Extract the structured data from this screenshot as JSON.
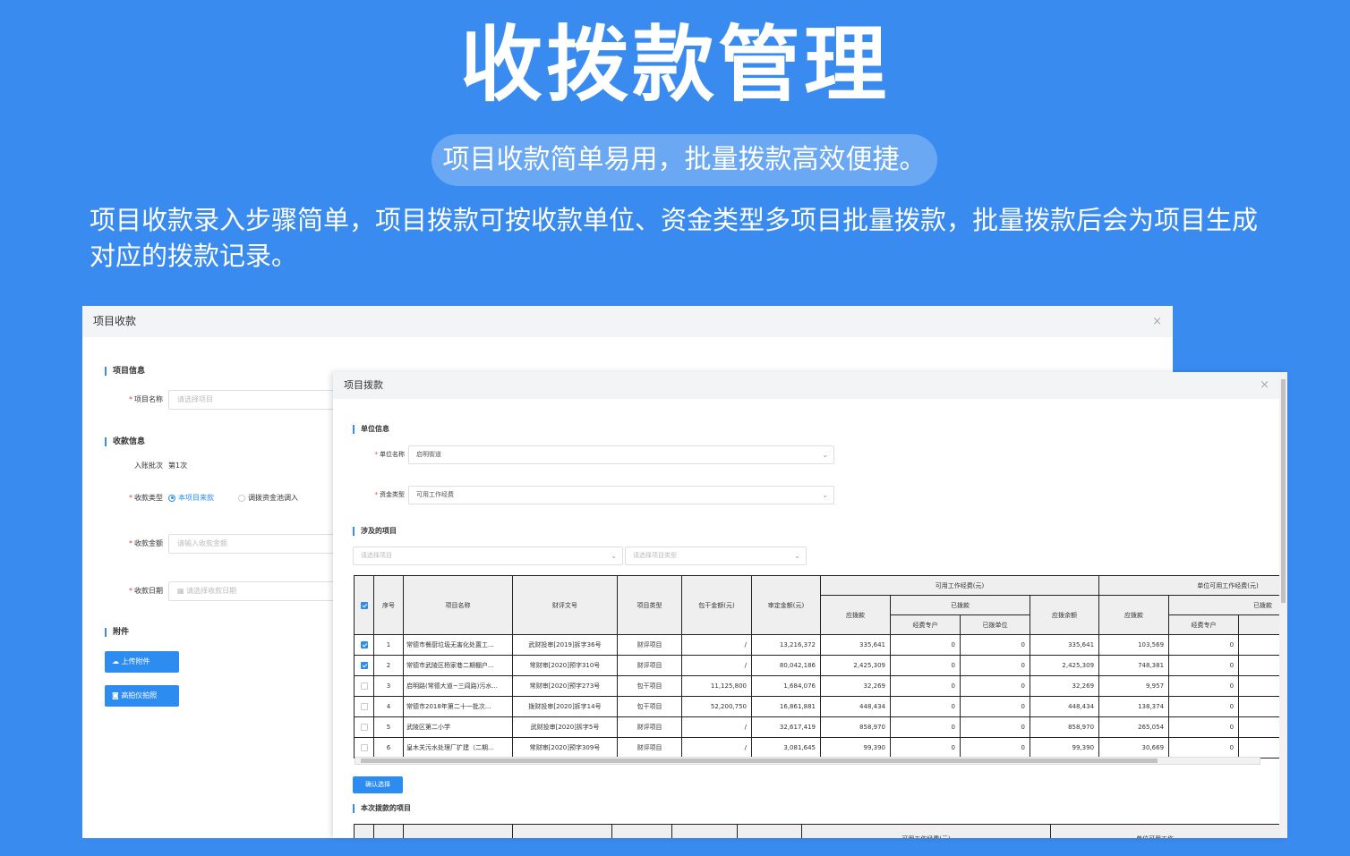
{
  "hero": {
    "title": "收拨款管理",
    "pill": "项目收款简单易用，批量拨款高效便捷。",
    "desc": "项目收款录入步骤简单，项目拨款可按收款单位、资金类型多项目批量拨款，批量拨款后会为项目生成对应的拨款记录。"
  },
  "receipt_dialog": {
    "title": "项目收款",
    "close": "×",
    "section_project": "项目信息",
    "project_name_label": "项目名称",
    "project_name_placeholder": "请选择项目",
    "section_receipt": "收款信息",
    "batch_label": "入账批次",
    "batch_value": "第1次",
    "type_label": "收款类型",
    "type_option_1": "本项目来款",
    "type_option_2": "调拨资金池调入",
    "amount_label": "收款金额",
    "amount_placeholder": "请输入收款金额",
    "date_label": "收款日期",
    "date_placeholder": "请选择收款日期",
    "section_attach": "附件",
    "upload_button": "上传附件",
    "camera_button": "高拍仪拍照"
  },
  "allocation_dialog": {
    "title": "项目拨款",
    "close": "×",
    "section_unit": "单位信息",
    "unit_name_label": "单位名称",
    "unit_name_value": "启明街道",
    "fund_type_label": "资金类型",
    "fund_type_value": "可用工作经费",
    "section_projects": "涉及的项目",
    "filter_project_placeholder": "请选择项目",
    "filter_type_placeholder": "请选择项目类型",
    "confirm_button": "确认选择",
    "section_current": "本次拨款的项目",
    "table": {
      "headers": {
        "seq": "序号",
        "name": "项目名称",
        "doc": "财评文号",
        "type": "项目类型",
        "contract": "包干金额(元)",
        "audit": "审定金额(元)",
        "group1": "可用工作经费(元)",
        "group2": "单位可用工作经费(元)",
        "payable": "应拨款",
        "allocated": "已拨款",
        "special": "经费专户",
        "unit_alloc": "已拨单位",
        "balance": "应拨余额"
      },
      "rows": [
        {
          "checked": true,
          "seq": "1",
          "name": "常德市餐厨垃圾无害化处置工...",
          "doc": "武财投审[2019]拆字36号",
          "type": "财评项目",
          "contract": "/",
          "audit": "13,216,372",
          "payable": "335,641",
          "special": "0",
          "unit_alloc": "0",
          "balance": "335,641",
          "payable2": "103,569",
          "special2": "0"
        },
        {
          "checked": true,
          "seq": "2",
          "name": "常德市武陵区杨家巷二期棚户...",
          "doc": "常财审[2020]预字310号",
          "type": "财评项目",
          "contract": "/",
          "audit": "80,042,186",
          "payable": "2,425,309",
          "special": "0",
          "unit_alloc": "0",
          "balance": "2,425,309",
          "payable2": "748,381",
          "special2": "0"
        },
        {
          "checked": false,
          "seq": "3",
          "name": "启明路(常德大道~三闾路)污水...",
          "doc": "常财审[2020]预字273号",
          "type": "包干项目",
          "contract": "11,125,800",
          "audit": "1,684,076",
          "payable": "32,269",
          "special": "0",
          "unit_alloc": "0",
          "balance": "32,269",
          "payable2": "9,957",
          "special2": "0"
        },
        {
          "checked": false,
          "seq": "4",
          "name": "常德市2018年第二十一批次...",
          "doc": "拨财投审[2020]拆字14号",
          "type": "包干项目",
          "contract": "52,200,750",
          "audit": "16,861,881",
          "payable": "448,434",
          "special": "0",
          "unit_alloc": "0",
          "balance": "448,434",
          "payable2": "138,374",
          "special2": "0"
        },
        {
          "checked": false,
          "seq": "5",
          "name": "武陵区第二小学",
          "doc": "武财投审[2020]拆字5号",
          "type": "财评项目",
          "contract": "/",
          "audit": "32,617,419",
          "payable": "858,970",
          "special": "0",
          "unit_alloc": "0",
          "balance": "858,970",
          "payable2": "265,054",
          "special2": "0"
        },
        {
          "checked": false,
          "seq": "6",
          "name": "皇木关污水处理厂扩建（二期...",
          "doc": "常财审[2020]预字309号",
          "type": "财评项目",
          "contract": "/",
          "audit": "3,081,645",
          "payable": "99,390",
          "special": "0",
          "unit_alloc": "0",
          "balance": "99,390",
          "payable2": "30,669",
          "special2": "0"
        }
      ],
      "bottom_group1": "可用工作经费(元)",
      "bottom_group2": "单位可用工作"
    }
  },
  "colors": {
    "background": "#3a8bf0",
    "primary": "#2d8cf0",
    "required": "#e53935"
  }
}
